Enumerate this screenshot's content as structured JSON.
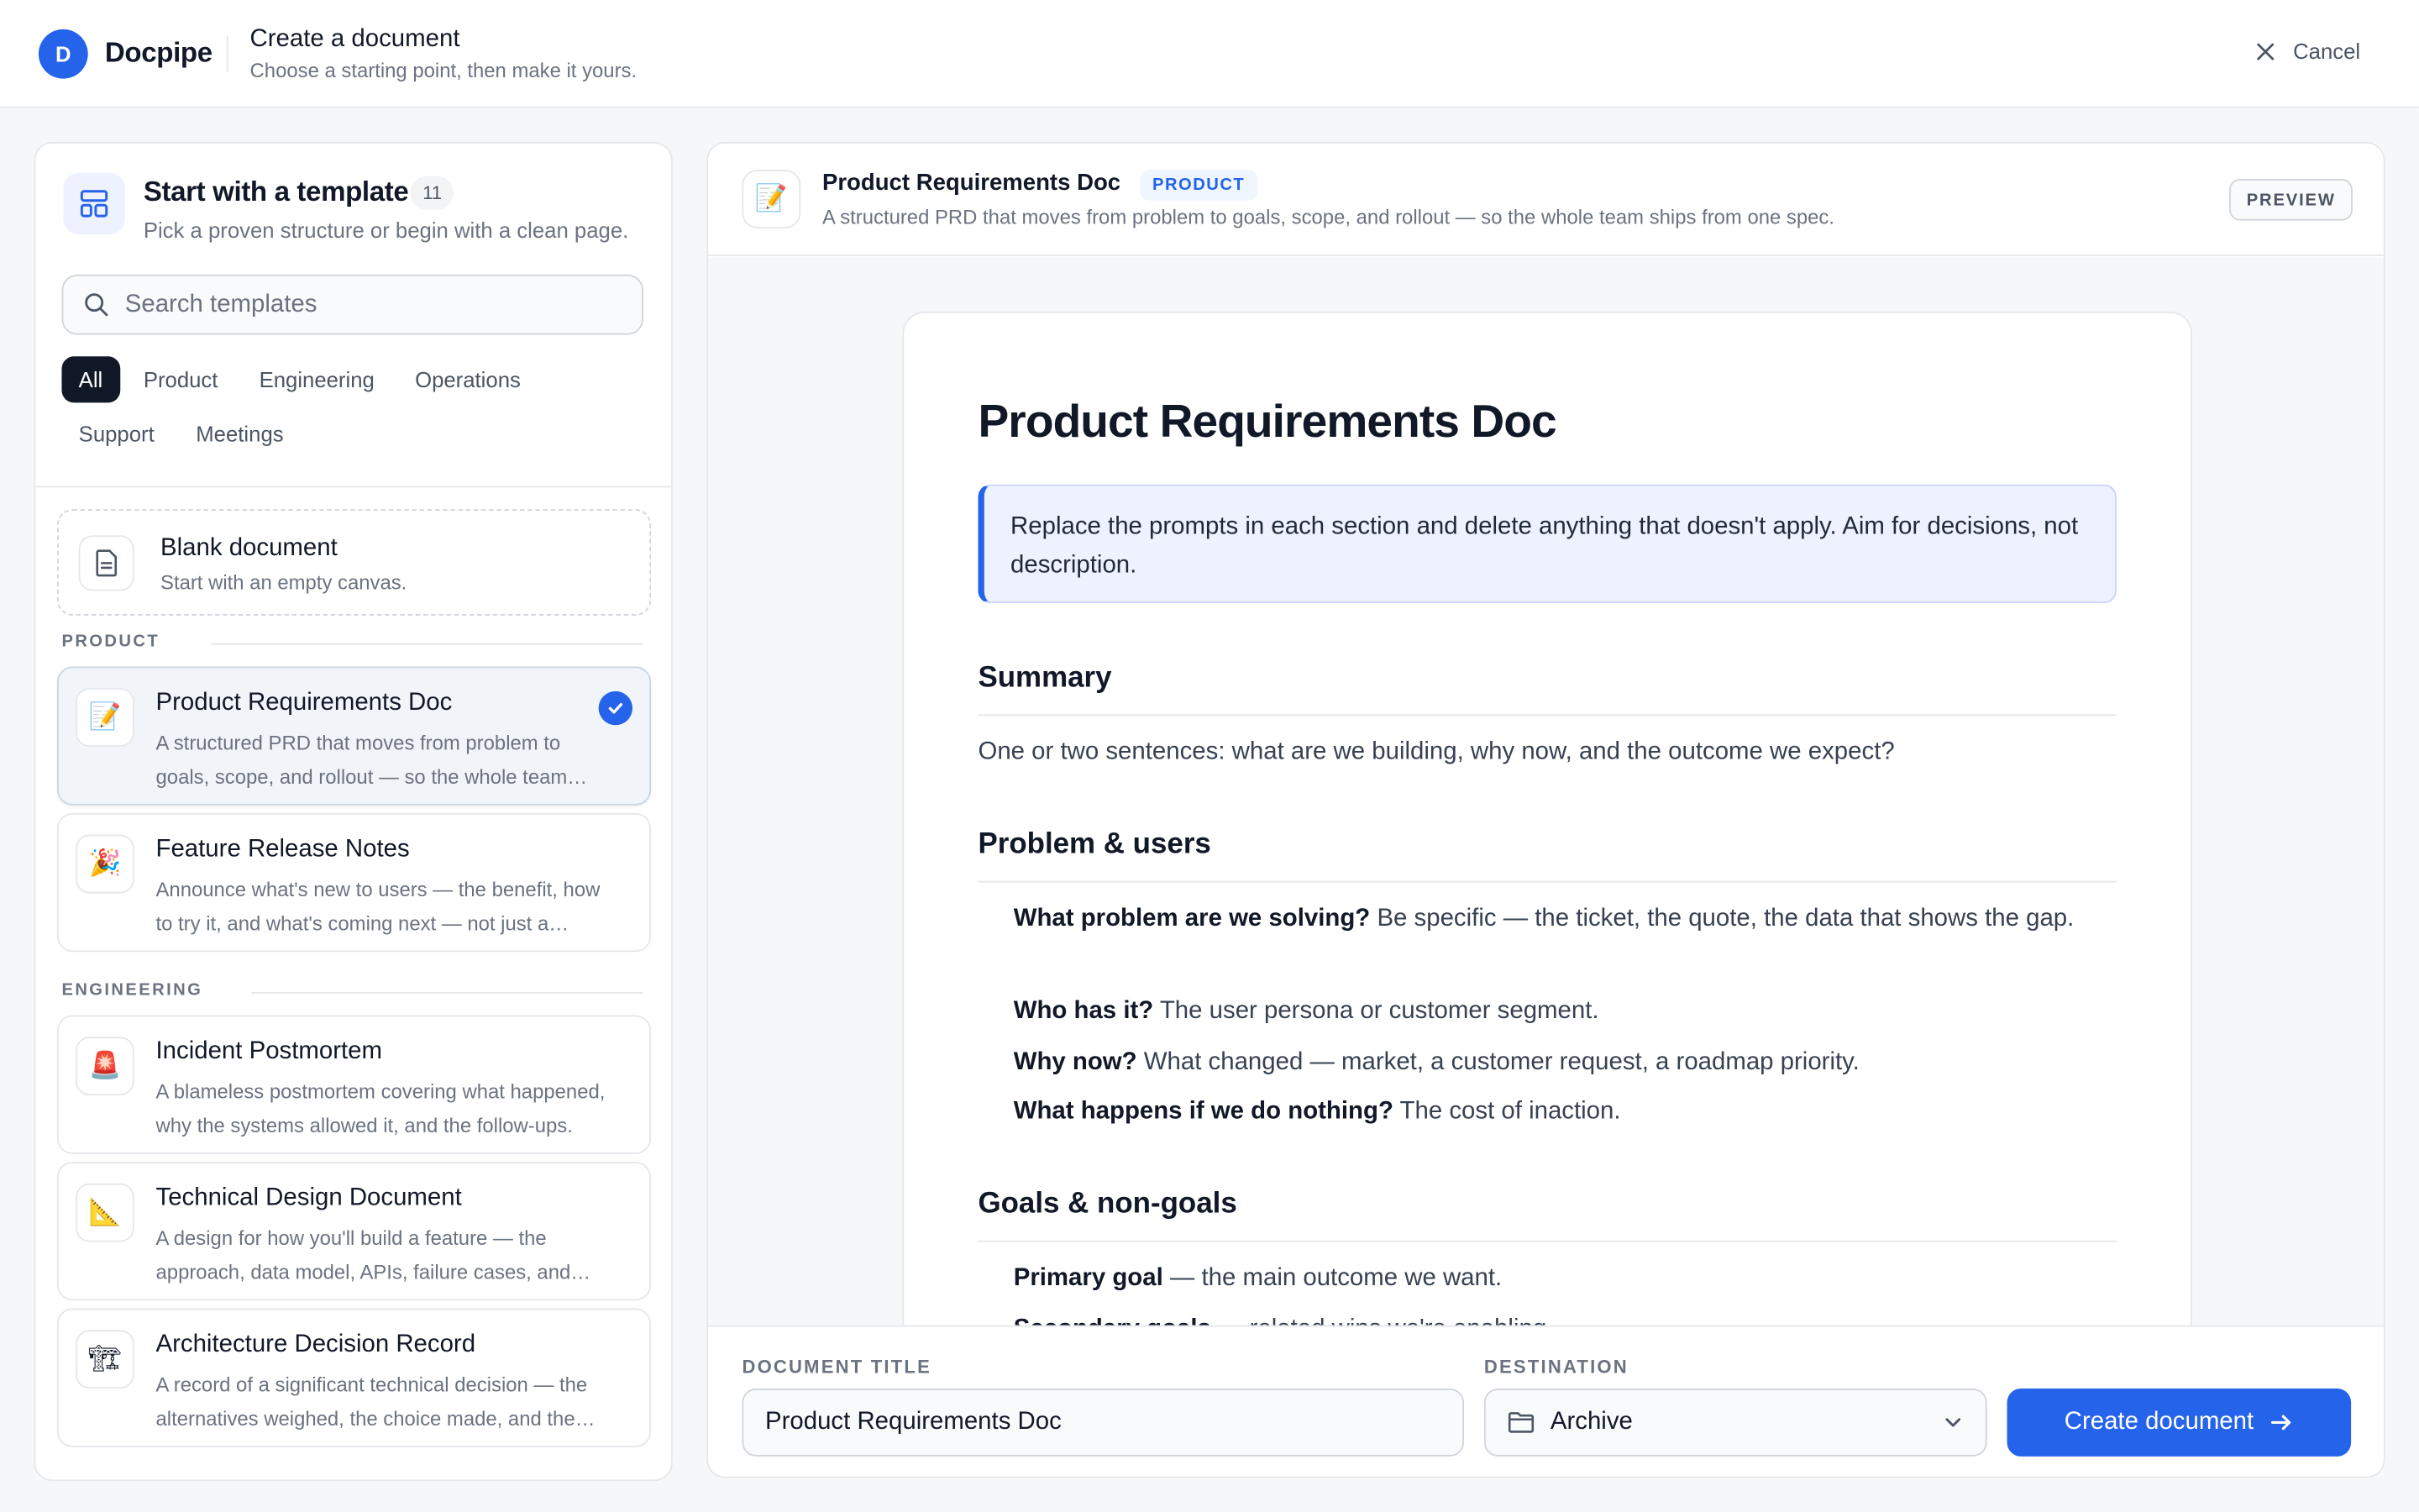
{
  "topbar": {
    "logo_letter": "D",
    "brand": "Docpipe",
    "title": "Create a document",
    "subtitle": "Choose a starting point, then make it yours.",
    "cancel_label": "Cancel"
  },
  "sidebar": {
    "title": "Start with a template",
    "count": "11",
    "subtitle": "Pick a proven structure or begin with a clean page.",
    "search_placeholder": "Search templates",
    "filters": [
      "All",
      "Product",
      "Engineering",
      "Operations",
      "Support",
      "Meetings"
    ],
    "active_filter": "All",
    "blank": {
      "title": "Blank document",
      "desc": "Start with an empty canvas.",
      "icon": "document-icon"
    },
    "groups": [
      {
        "label": "PRODUCT",
        "items": [
          {
            "icon": "📝",
            "title": "Product Requirements Doc",
            "desc": "A structured PRD that moves from problem to goals, scope, and rollout — so the whole team ships from one spec.",
            "selected": true
          },
          {
            "icon": "🎉",
            "title": "Feature Release Notes",
            "desc": "Announce what's new to users — the benefit, how to try it, and what's coming next — not just a changelog."
          }
        ]
      },
      {
        "label": "ENGINEERING",
        "items": [
          {
            "icon": "🚨",
            "title": "Incident Postmortem",
            "desc": "A blameless postmortem covering what happened, why the systems allowed it, and the follow-ups."
          },
          {
            "icon": "📐",
            "title": "Technical Design Document",
            "desc": "A design for how you'll build a feature — the approach, data model, APIs, failure cases, and rollout."
          },
          {
            "icon": "🏗",
            "title": "Architecture Decision Record",
            "desc": "A record of a significant technical decision — the alternatives weighed, the choice made, and the consequences."
          }
        ]
      }
    ]
  },
  "preview": {
    "icon": "📝",
    "title": "Product Requirements Doc",
    "badge": "PRODUCT",
    "subtitle": "A structured PRD that moves from problem to goals, scope, and rollout — so the whole team ships from one spec.",
    "pill": "PREVIEW",
    "doc": {
      "h1": "Product Requirements Doc",
      "callout": "Replace the prompts in each section and delete anything that doesn't apply. Aim for decisions, not description.",
      "summary_h": "Summary",
      "summary_p": "One or two sentences: what are we building, why now, and the outcome we expect?",
      "problem_h": "Problem & users",
      "problem_items": [
        {
          "b": "What problem are we solving?",
          "t": " Be specific — the ticket, the quote, the data that shows the gap."
        },
        {
          "b": "Who has it?",
          "t": " The user persona or customer segment."
        },
        {
          "b": "Why now?",
          "t": " What changed — market, a customer request, a roadmap priority."
        },
        {
          "b": "What happens if we do nothing?",
          "t": " The cost of inaction."
        }
      ],
      "goals_h": "Goals & non-goals",
      "goals_items": [
        {
          "b": "Primary goal",
          "t": " — the main outcome we want."
        },
        {
          "b": "Secondary goals",
          "t": " — related wins we're enabling."
        }
      ]
    }
  },
  "footer": {
    "title_label": "DOCUMENT TITLE",
    "title_value": "Product Requirements Doc",
    "dest_label": "DESTINATION",
    "dest_value": "Archive",
    "create_label": "Create document"
  },
  "colors": {
    "accent": "#2563eb",
    "dark": "#111827"
  }
}
